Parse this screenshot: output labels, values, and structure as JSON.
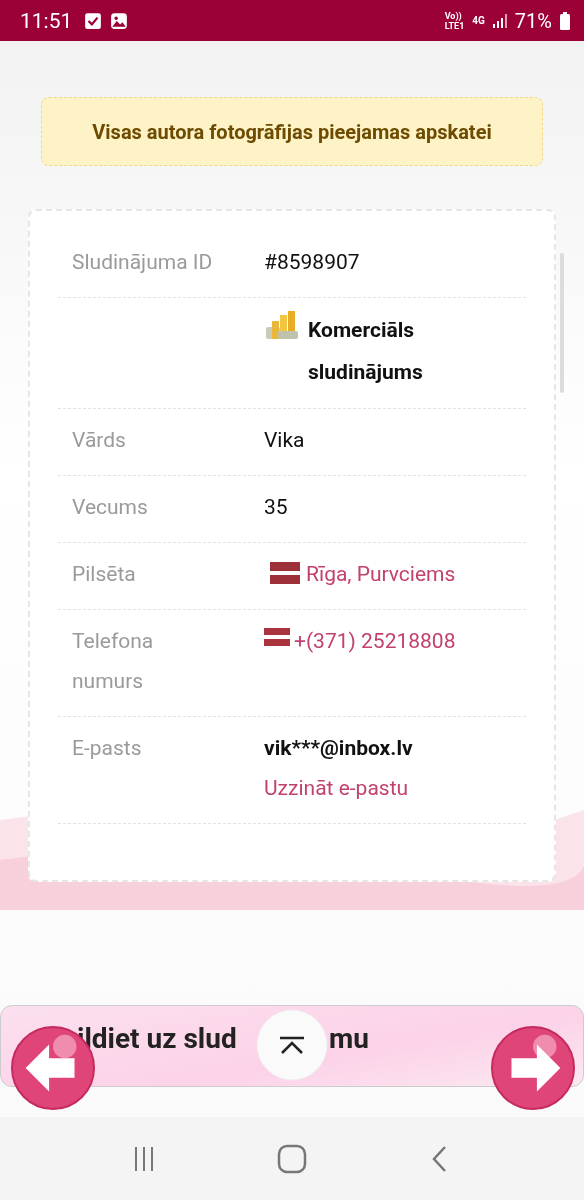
{
  "status_bar": {
    "time": "11:51",
    "volte": "Vo))",
    "lte": "LTE1",
    "network": "4G",
    "battery": "71%"
  },
  "notice": {
    "text": "Visas autora fotogrāfijas pieejamas apskatei"
  },
  "details": [
    {
      "kind": "text",
      "label": "Sludinājuma ID",
      "value": "#8598907"
    },
    {
      "kind": "commercial",
      "value": "Komerciāls sludinājums"
    },
    {
      "kind": "text",
      "label": "Vārds",
      "value": "Vika"
    },
    {
      "kind": "text",
      "label": "Vecums",
      "value": "35"
    },
    {
      "kind": "location",
      "label": "Pilsēta",
      "value": "Rīga, Purvciems"
    },
    {
      "kind": "phone",
      "label": "Telefona numurs",
      "value": "+(371) 25218808"
    },
    {
      "kind": "email",
      "label": "E-pasts",
      "value": "vik***@inbox.lv",
      "link": "Uzzināt e-pastu"
    }
  ],
  "next_card": {
    "heading_parts": [
      "ildiet uz slud",
      "mu"
    ]
  }
}
